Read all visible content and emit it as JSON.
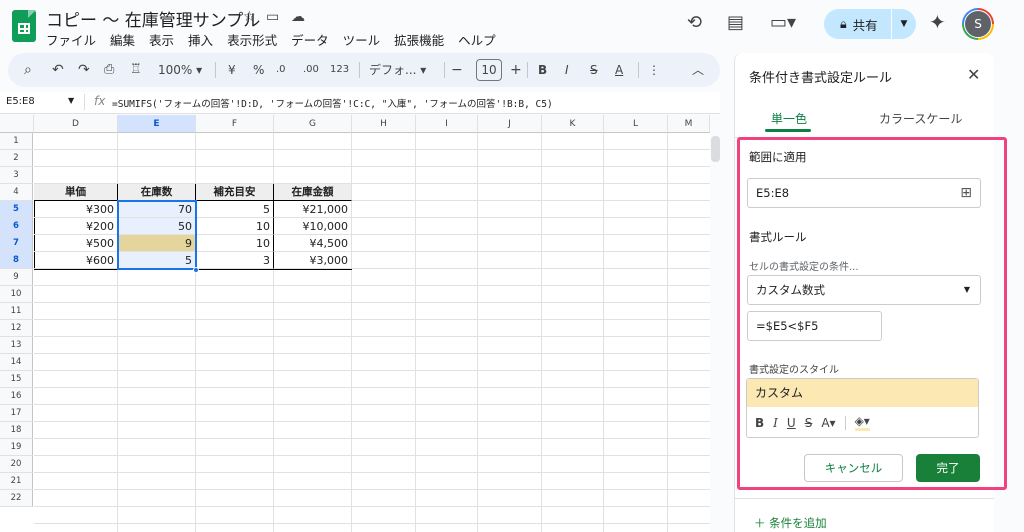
{
  "doc": {
    "title": "コピー 〜 在庫管理サンプル"
  },
  "menu": [
    "ファイル",
    "編集",
    "表示",
    "挿入",
    "表示形式",
    "データ",
    "ツール",
    "拡張機能",
    "ヘルプ"
  ],
  "header": {
    "share_label": "共有",
    "avatar_letter": "S"
  },
  "toolbar": {
    "zoom": "100%",
    "currency": "¥",
    "percent": "%",
    "dec_less": ".0",
    "dec_more": ".00",
    "number_fmt": "123",
    "font": "デフォ...",
    "font_size": "10",
    "bold": "B",
    "italic": "I",
    "strike": "S",
    "text_color": "A"
  },
  "formula_bar": {
    "name_box": "E5:E8",
    "fx": "fx",
    "formula": "=SUMIFS('フォームの回答'!D:D, 'フォームの回答'!C:C, \"入庫\", 'フォームの回答'!B:B, C5)"
  },
  "sheet": {
    "columns": [
      "D",
      "E",
      "F",
      "G",
      "H",
      "I",
      "J",
      "K",
      "L",
      "M"
    ],
    "rows": [
      "1",
      "2",
      "3",
      "4",
      "5",
      "6",
      "7",
      "8",
      "9",
      "10",
      "11",
      "12",
      "13",
      "14",
      "15",
      "16",
      "17",
      "18",
      "19",
      "20",
      "21",
      "22"
    ],
    "table_headers": [
      "単価",
      "在庫数",
      "補充目安",
      "在庫金額"
    ],
    "table_rows": [
      [
        "¥300",
        "70",
        "5",
        "¥21,000"
      ],
      [
        "¥200",
        "50",
        "10",
        "¥10,000"
      ],
      [
        "¥500",
        "9",
        "10",
        "¥4,500"
      ],
      [
        "¥600",
        "5",
        "3",
        "¥3,000"
      ]
    ]
  },
  "panel": {
    "title": "条件付き書式設定ルール",
    "tab_single": "単一色",
    "tab_scale": "カラースケール",
    "range_label": "範囲に適用",
    "range_value": "E5:E8",
    "rules_label": "書式ルール",
    "condition_label": "セルの書式設定の条件...",
    "condition_value": "カスタム数式",
    "formula_value": "=$E5<$F5",
    "style_label": "書式設定のスタイル",
    "style_preview": "カスタム",
    "cancel": "キャンセル",
    "done": "完了",
    "add_rule": "条件を追加"
  },
  "colors": {
    "accent": "#188038",
    "highlight": "#f0427c",
    "rule_fill": "#fce8b2",
    "selection": "#e8f0fe"
  }
}
